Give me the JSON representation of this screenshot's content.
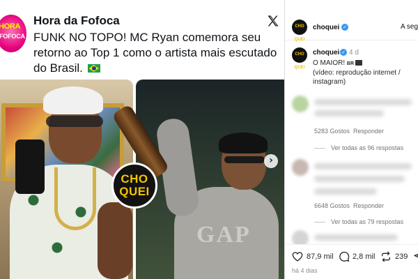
{
  "tweet": {
    "account_name": "Hora da Fofoca",
    "avatar_logo_line1": "HORA",
    "avatar_logo_line2": "FOFOCA",
    "text": "FUNK NO TOPO! MC Ryan comemora seu retorno ao Top 1 como o artista mais escutado do Brasil.",
    "flag_icon": "brazil-flag-icon",
    "platform_icon": "x-logo-icon",
    "photo_watermark_line1": "CHO",
    "photo_watermark_line2": "QUEI",
    "photo_shirt_text": "GAP",
    "next_icon": "chevron-right-icon"
  },
  "instagram": {
    "header": {
      "username": "choquei",
      "follow_label": "A seguir",
      "avatar_text_1": "CHO",
      "avatar_text_2": "QUEI"
    },
    "post": {
      "username": "choquei",
      "time": "4 d",
      "caption_line1": "O MAIOR!",
      "caption_flag": "BR",
      "caption_rest": "(vídeo: reprodução internet / instagram)"
    },
    "comments": [
      {
        "likes": "5283 Gostos",
        "reply": "Responder",
        "view_replies": "Ver todas as 96 respostas"
      },
      {
        "likes": "6648 Gostos",
        "reply": "Responder",
        "view_replies": "Ver todas as 79 respostas"
      }
    ],
    "actions": {
      "likes_count": "87,9 mil",
      "comments_count": "2,8 mil",
      "reposts_count": "239",
      "date": "há 4 dias"
    }
  },
  "colors": {
    "verified_blue": "#3897f0",
    "brand_pink": "#e6007e",
    "choquei_yellow": "#f2c500"
  }
}
